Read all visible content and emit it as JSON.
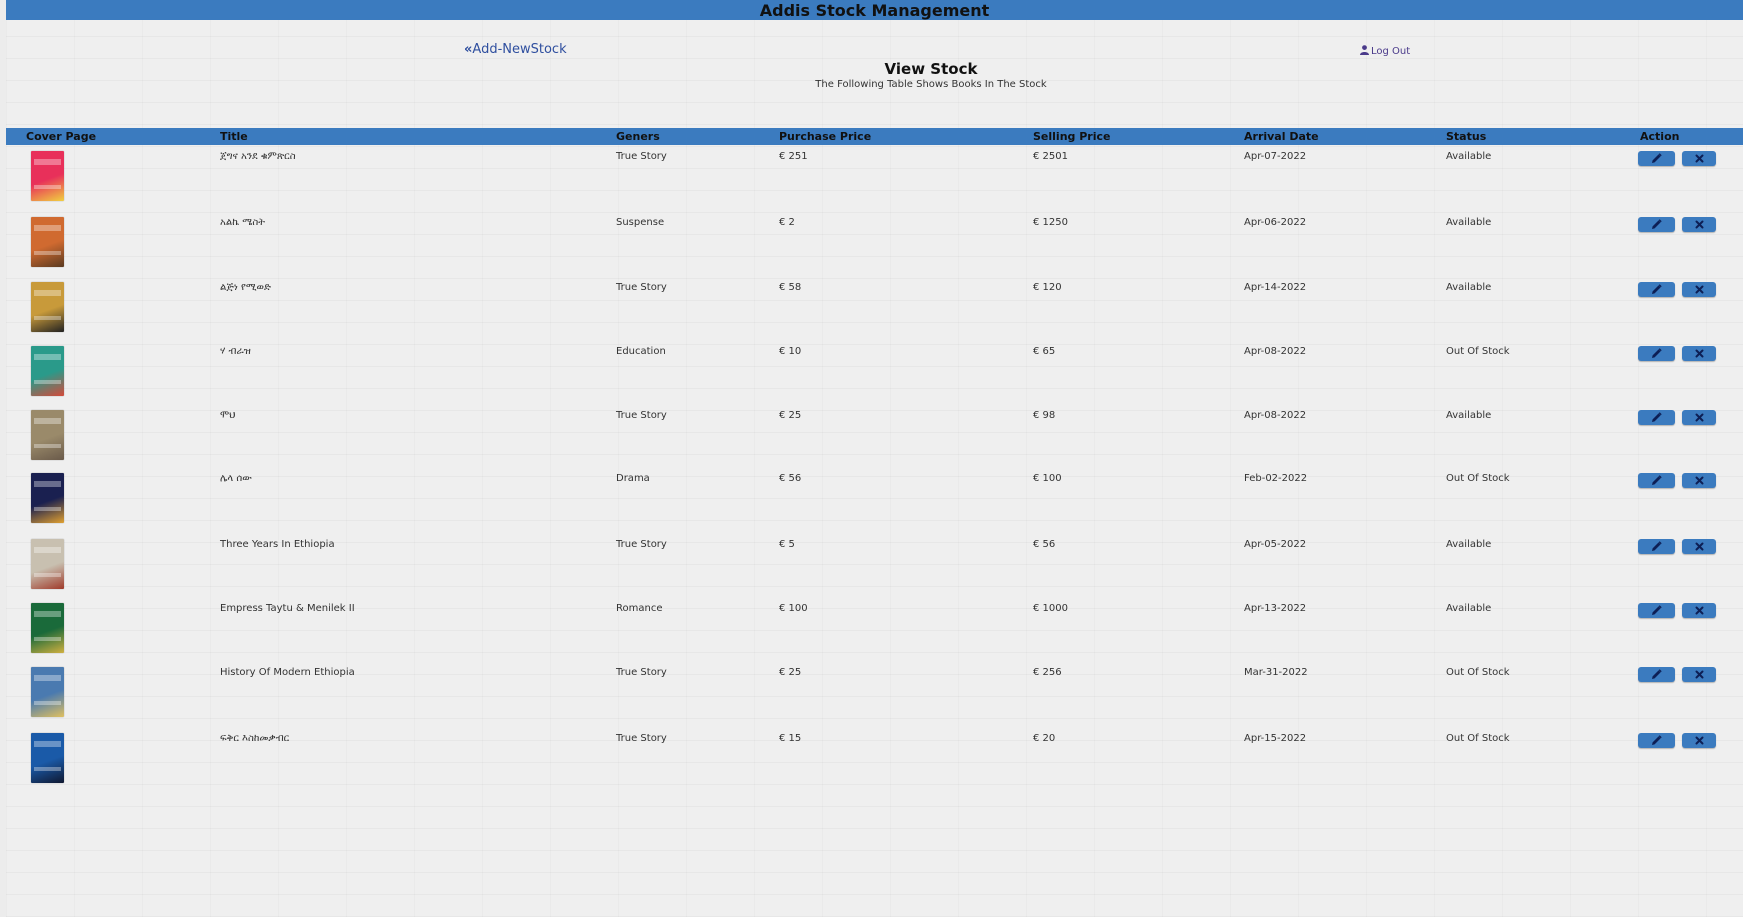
{
  "header": {
    "title": "Addis Stock Management"
  },
  "nav": {
    "add_link": "Add-NewStock",
    "logout": "Log Out"
  },
  "main": {
    "title": "View Stock",
    "subtitle": "The Following Table Shows Books In The Stock"
  },
  "table": {
    "columns": [
      "Cover Page",
      "Title",
      "Geners",
      "Purchase Price",
      "Selling Price",
      "Arrival Date",
      "Status",
      "Action"
    ],
    "rows": [
      {
        "title": "ጀግና አንደ ቁምጽርስ",
        "genre": "True Story",
        "purchase": "€ 251",
        "selling": "€ 2501",
        "arrival": "Apr-07-2022",
        "status": "Available",
        "cover_colors": [
          "#e8305a",
          "#f0d040"
        ]
      },
      {
        "title": "አልኬ ሜስት",
        "genre": "Suspense",
        "purchase": "€ 2",
        "selling": "€ 1250",
        "arrival": "Apr-06-2022",
        "status": "Available",
        "cover_colors": [
          "#d06a30",
          "#5a3a20"
        ]
      },
      {
        "title": "ልጅነ የሚወድ",
        "genre": "True Story",
        "purchase": "€ 58",
        "selling": "€ 120",
        "arrival": "Apr-14-2022",
        "status": "Available",
        "cover_colors": [
          "#c89a3a",
          "#222222"
        ]
      },
      {
        "title": "ሃ ብራዝ",
        "genre": "Education",
        "purchase": "€ 10",
        "selling": "€ 65",
        "arrival": "Apr-08-2022",
        "status": "Out Of Stock",
        "cover_colors": [
          "#2a9a8a",
          "#d44a3a"
        ]
      },
      {
        "title": "ሞህ",
        "genre": "True Story",
        "purchase": "€ 25",
        "selling": "€ 98",
        "arrival": "Apr-08-2022",
        "status": "Available",
        "cover_colors": [
          "#9a8a6a",
          "#6a5a4a"
        ]
      },
      {
        "title": "ሌላ ሰው",
        "genre": "Drama",
        "purchase": "€ 56",
        "selling": "€ 100",
        "arrival": "Feb-02-2022",
        "status": "Out Of Stock",
        "cover_colors": [
          "#1a2050",
          "#e0a030"
        ]
      },
      {
        "title": "Three Years In Ethiopia",
        "genre": "True Story",
        "purchase": "€ 5",
        "selling": "€ 56",
        "arrival": "Apr-05-2022",
        "status": "Available",
        "cover_colors": [
          "#c8c0b0",
          "#a03a2a"
        ]
      },
      {
        "title": "Empress Taytu & Menilek II",
        "genre": "Romance",
        "purchase": "€ 100",
        "selling": "€ 1000",
        "arrival": "Apr-13-2022",
        "status": "Available",
        "cover_colors": [
          "#1a6a3a",
          "#d0b040"
        ]
      },
      {
        "title": "History Of Modern Ethiopia",
        "genre": "True Story",
        "purchase": "€ 25",
        "selling": "€ 256",
        "arrival": "Mar-31-2022",
        "status": "Out Of Stock",
        "cover_colors": [
          "#4a7ab0",
          "#e0c060"
        ]
      },
      {
        "title": "ፍቅር እስከመቃብር",
        "genre": "True Story",
        "purchase": "€ 15",
        "selling": "€ 20",
        "arrival": "Apr-15-2022",
        "status": "Out Of Stock",
        "cover_colors": [
          "#1a5aa8",
          "#101830"
        ]
      }
    ]
  },
  "colors": {
    "primary": "#3b7bbf",
    "background": "#efefef"
  },
  "icons": {
    "edit": "pencil-icon",
    "delete": "close-icon",
    "back": "double-chevron-left-icon",
    "user": "user-icon"
  }
}
